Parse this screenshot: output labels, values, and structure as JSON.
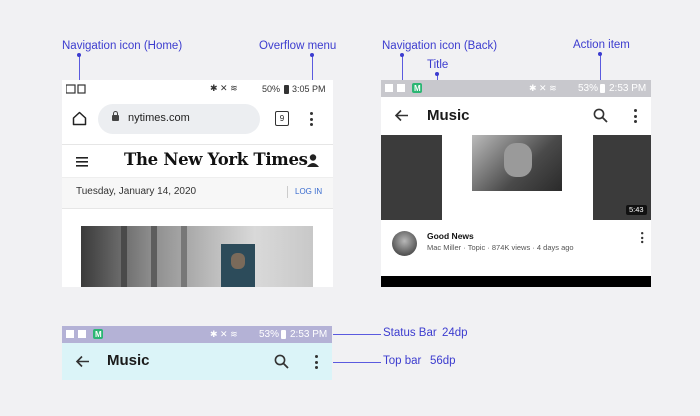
{
  "annotations": {
    "nav_home": "Navigation icon (Home)",
    "overflow": "Overflow menu",
    "nav_back": "Navigation icon (Back)",
    "title": "Title",
    "action_item": "Action item",
    "status_bar": "Status Bar",
    "status_bar_size": "24dp",
    "top_bar": "Top bar",
    "top_bar_size": "56dp"
  },
  "browser": {
    "status_battery": "50%",
    "status_time": "3:05 PM",
    "url": "nytimes.com",
    "tab_count": "9",
    "site_logo": "The New York Times",
    "date": "Tuesday, January 14, 2020",
    "login": "LOG IN"
  },
  "music_app": {
    "status_battery": "53%",
    "status_time": "2:53 PM",
    "title": "Music",
    "video_duration": "5:43",
    "video_title": "Good News",
    "video_meta": "Mac Miller · Topic · 874K views · 4 days ago"
  },
  "zoom_bar": {
    "status_battery": "53%",
    "status_time": "2:53 PM",
    "title": "Music"
  },
  "colors": {
    "annotation": "#3c3ccf",
    "status_bar_highlight": "#b4b2d6",
    "top_bar_highlight": "#dbf4f8"
  }
}
